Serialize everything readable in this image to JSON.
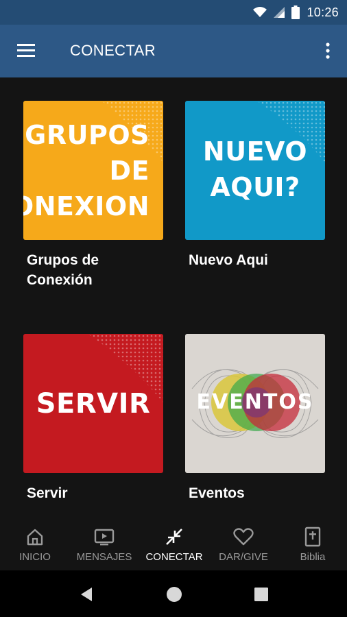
{
  "status_bar": {
    "time": "10:26",
    "icons": [
      "wifi-icon",
      "cell-signal-icon",
      "battery-icon"
    ]
  },
  "app_bar": {
    "title": "CONECTAR",
    "menu_icon": "hamburger-menu-icon",
    "overflow_icon": "more-vertical-icon"
  },
  "cards": [
    {
      "tile_lines": [
        "GRUPOS",
        "DE",
        "CONEXION"
      ],
      "label": "Grupos de Conexión",
      "tile_color": "#f6a91a"
    },
    {
      "tile_lines": [
        "NUEVO",
        "AQUI?"
      ],
      "label": "Nuevo Aqui",
      "tile_color": "#1199c8"
    },
    {
      "tile_lines": [
        "SERVIR"
      ],
      "label": "Servir",
      "tile_color": "#c41a20"
    },
    {
      "tile_lines": [
        "EVENTOS"
      ],
      "label": "Eventos",
      "tile_color": "#dad6d1"
    }
  ],
  "bottom_nav": {
    "active": "CONECTAR",
    "items": [
      {
        "label": "INICIO",
        "icon": "home-icon"
      },
      {
        "label": "MENSAJES",
        "icon": "tv-icon"
      },
      {
        "label": "CONECTAR",
        "icon": "collapse-arrows-icon"
      },
      {
        "label": "DAR/GIVE",
        "icon": "heart-icon"
      },
      {
        "label": "Biblia",
        "icon": "bible-icon"
      }
    ]
  },
  "system_nav": [
    "back-icon",
    "home-circle-icon",
    "recents-icon"
  ],
  "colors": {
    "status_bar": "#244c74",
    "app_bar": "#2d5886",
    "background": "#141414",
    "nav_inactive": "#9a9a9a"
  }
}
